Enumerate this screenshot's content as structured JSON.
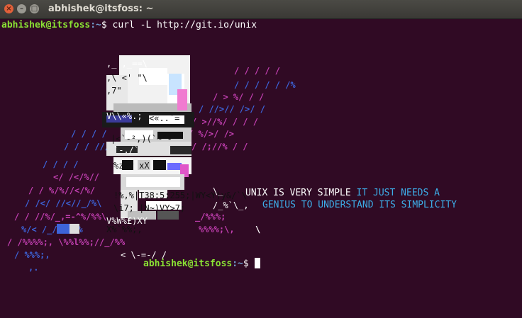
{
  "window": {
    "title": "abhishek@itsfoss: ~"
  },
  "prompt1": {
    "user": "abhishek@itsfoss",
    "path": ":~",
    "symbol": "$ ",
    "command": "curl -L http://git.io/unix"
  },
  "message": {
    "line1_white": "UNIX IS VERY SIMPLE ",
    "line1_blue": "IT JUST NEEDS A",
    "line2_blue": "GENIUS TO UNDERSTAND ITS SIMPLICITY"
  },
  "prompt2": {
    "user": "abhishek@itsfoss",
    "path": ":~",
    "symbol": "$ "
  },
  "colors": {
    "background": "#300a24",
    "prompt_user": "#8ae234",
    "prompt_path": "#729fcf",
    "accent_blue": "#3daee9",
    "magenta": "#c13fb0",
    "white": "#ffffff"
  }
}
